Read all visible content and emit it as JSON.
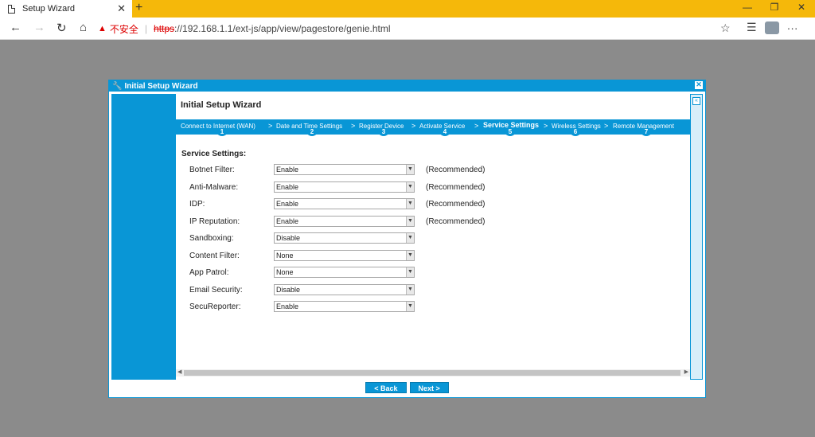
{
  "browser": {
    "tab_title": "Setup Wizard",
    "tab_close": "✕",
    "new_tab": "+",
    "win_min": "—",
    "win_restore": "❐",
    "win_close": "✕",
    "back": "←",
    "forward": "→",
    "reload": "↻",
    "home": "⌂",
    "warning_icon": "▲",
    "security_label": "不安全",
    "url_scheme": "https",
    "url_rest": "://192.168.1.1/ext-js/app/view/pagestore/genie.html",
    "favorite": "☆",
    "favorites_bar": "☰",
    "menu": "···"
  },
  "dialog": {
    "title": "Initial Setup Wizard",
    "close": "✕",
    "wizard_title": "Initial Setup Wizard",
    "collapse": "«",
    "steps": [
      {
        "label": "Connect to Internet (WAN)",
        "number": "1",
        "active": false
      },
      {
        "label": "Date and Time Settings",
        "number": "2",
        "active": false
      },
      {
        "label": "Register Device",
        "number": "3",
        "active": false
      },
      {
        "label": "Activate Service",
        "number": "4",
        "active": false
      },
      {
        "label": "Service Settings",
        "number": "5",
        "active": true
      },
      {
        "label": "Wireless Settings",
        "number": "6",
        "active": false
      },
      {
        "label": "Remote Management",
        "number": "7",
        "active": false
      }
    ],
    "step_separator": ">",
    "section_title": "Service Settings:",
    "settings": [
      {
        "label": "Botnet Filter:",
        "value": "Enable",
        "note": "(Recommended)"
      },
      {
        "label": "Anti-Malware:",
        "value": "Enable",
        "note": "(Recommended)"
      },
      {
        "label": "IDP:",
        "value": "Enable",
        "note": "(Recommended)"
      },
      {
        "label": "IP Reputation:",
        "value": "Enable",
        "note": "(Recommended)"
      },
      {
        "label": "Sandboxing:",
        "value": "Disable",
        "note": ""
      },
      {
        "label": "Content Filter:",
        "value": "None",
        "note": ""
      },
      {
        "label": "App Patrol:",
        "value": "None",
        "note": ""
      },
      {
        "label": "Email Security:",
        "value": "Disable",
        "note": ""
      },
      {
        "label": "SecuReporter:",
        "value": "Enable",
        "note": ""
      }
    ],
    "dropdown_arrow": "▼",
    "back_button": "< Back",
    "next_button": "Next >"
  },
  "colors": {
    "accent": "#0996d6",
    "tabbar": "#f5b80a",
    "background": "#8b8b8b"
  }
}
